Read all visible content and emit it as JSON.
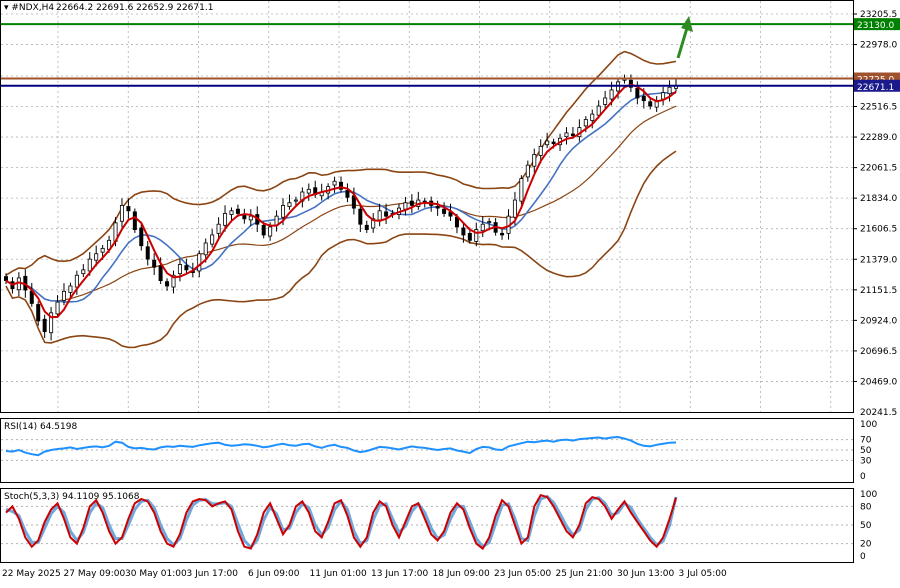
{
  "header": {
    "symbol": "#NDX,H4",
    "ohlc": "22664.2 22691.6 22652.9 22671.1"
  },
  "colors": {
    "candle": "#000000",
    "bollinger": "#8b4513",
    "ma_fast": "#cc0000",
    "ma_slow": "#4472c4",
    "rsi": "#1e90ff",
    "stoch_main": "#cc0000",
    "stoch_signal": "#6fa8dc",
    "hline_green": "#008000",
    "hline_brown": "#a0522d",
    "hline_navy": "#000080",
    "label_green": "#008000",
    "label_brown": "#a0522d",
    "label_navy": "#1a1a8c",
    "arrow": "#2e8b22",
    "grid": "#b0b0b0"
  },
  "chart_data": [
    {
      "type": "candlestick",
      "title": "#NDX,H4",
      "ylim": [
        20241.5,
        23205.5
      ],
      "price_ticks": [
        20241.5,
        20469.0,
        20696.5,
        20924.0,
        21151.5,
        21379.0,
        21606.5,
        21834.0,
        22061.5,
        22289.0,
        22516.5,
        22744.0,
        22971.5
      ],
      "price_tick_labels": [
        "20241.5",
        "20469.0",
        "20696.5",
        "20924.0",
        "21151.5",
        "21379.0",
        "21606.5",
        "21834.0",
        "22061.5",
        "22289.0",
        "22516.5",
        "22744.0",
        "22978.0",
        "23205.5"
      ],
      "x_labels": [
        "22 May 2025",
        "27 May 09:00",
        "30 May 01:00",
        "3 Jun 17:00",
        "6 Jun 09:00",
        "11 Jun 01:00",
        "13 Jun 17:00",
        "18 Jun 09:00",
        "23 Jun 05:00",
        "25 Jun 21:00",
        "30 Jun 13:00",
        "3 Jul 05:00"
      ],
      "hlines": [
        {
          "name": "target",
          "value": 23130.0,
          "label": "23130.0",
          "color": "green"
        },
        {
          "name": "resistance",
          "value": 22725.0,
          "label": "22725.0",
          "color": "brown"
        },
        {
          "name": "current",
          "value": 22671.1,
          "label": "22671.1",
          "color": "navy"
        }
      ],
      "closes": [
        21220,
        21160,
        21240,
        21150,
        21050,
        20920,
        20840,
        20980,
        21060,
        21140,
        21180,
        21260,
        21300,
        21380,
        21420,
        21460,
        21520,
        21650,
        21780,
        21740,
        21600,
        21480,
        21380,
        21320,
        21220,
        21180,
        21260,
        21340,
        21300,
        21280,
        21420,
        21500,
        21560,
        21640,
        21720,
        21740,
        21720,
        21680,
        21700,
        21640,
        21560,
        21620,
        21700,
        21780,
        21800,
        21820,
        21880,
        21900,
        21860,
        21880,
        21920,
        21960,
        21900,
        21840,
        21760,
        21640,
        21600,
        21680,
        21740,
        21700,
        21720,
        21760,
        21800,
        21780,
        21820,
        21800,
        21780,
        21760,
        21720,
        21700,
        21620,
        21560,
        21520,
        21600,
        21640,
        21660,
        21580,
        21560,
        21700,
        21820,
        21980,
        22080,
        22160,
        22220,
        22260,
        22240,
        22280,
        22320,
        22300,
        22360,
        22420,
        22460,
        22520,
        22580,
        22640,
        22700,
        22720,
        22660,
        22580,
        22560,
        22520,
        22560,
        22620,
        22660,
        22671
      ]
    },
    {
      "type": "line",
      "title": "RSI(14) 64.5198",
      "ylim": [
        0,
        100
      ],
      "ticks": [
        0,
        30,
        50,
        70,
        100
      ],
      "values": [
        48,
        47,
        50,
        45,
        42,
        40,
        47,
        50,
        52,
        53,
        55,
        52,
        54,
        56,
        57,
        55,
        58,
        66,
        64,
        56,
        53,
        54,
        52,
        51,
        55,
        57,
        56,
        58,
        57,
        56,
        59,
        61,
        63,
        64,
        60,
        58,
        59,
        61,
        60,
        58,
        55,
        57,
        60,
        62,
        59,
        58,
        61,
        62,
        57,
        54,
        58,
        60,
        56,
        54,
        49,
        46,
        48,
        52,
        56,
        55,
        53,
        51,
        54,
        57,
        55,
        54,
        52,
        50,
        52,
        53,
        49,
        47,
        44,
        52,
        56,
        55,
        51,
        50,
        57,
        60,
        63,
        66,
        65,
        67,
        68,
        66,
        69,
        70,
        68,
        71,
        72,
        73,
        74,
        72,
        74,
        75,
        72,
        68,
        62,
        58,
        57,
        60,
        62,
        64,
        64.5
      ]
    },
    {
      "type": "line",
      "title": "Stoch(5,3,3) 94.1109 95.1068",
      "ylim": [
        0,
        100
      ],
      "ticks": [
        0,
        20,
        50,
        80,
        100
      ],
      "series": [
        {
          "values": [
            70,
            80,
            60,
            30,
            15,
            25,
            55,
            75,
            85,
            60,
            30,
            20,
            45,
            80,
            90,
            70,
            40,
            20,
            30,
            60,
            85,
            92,
            88,
            70,
            40,
            20,
            15,
            35,
            70,
            88,
            92,
            90,
            80,
            85,
            88,
            75,
            40,
            15,
            12,
            35,
            70,
            85,
            60,
            35,
            50,
            80,
            88,
            70,
            40,
            30,
            55,
            85,
            90,
            65,
            30,
            15,
            30,
            70,
            88,
            80,
            50,
            30,
            55,
            80,
            85,
            60,
            35,
            25,
            40,
            70,
            85,
            75,
            45,
            20,
            12,
            30,
            65,
            90,
            80,
            50,
            20,
            30,
            80,
            98,
            95,
            80,
            60,
            40,
            30,
            50,
            85,
            95,
            92,
            80,
            60,
            75,
            88,
            70,
            55,
            40,
            25,
            15,
            30,
            60,
            94.1
          ]
        },
        {
          "values": [
            75,
            72,
            65,
            40,
            22,
            22,
            45,
            68,
            80,
            70,
            40,
            25,
            38,
            70,
            85,
            78,
            50,
            28,
            28,
            50,
            75,
            88,
            90,
            78,
            50,
            28,
            18,
            28,
            58,
            82,
            90,
            91,
            84,
            84,
            86,
            80,
            52,
            25,
            14,
            26,
            58,
            78,
            68,
            42,
            45,
            70,
            84,
            78,
            50,
            34,
            46,
            75,
            88,
            75,
            40,
            20,
            25,
            58,
            82,
            84,
            60,
            38,
            48,
            72,
            84,
            70,
            45,
            28,
            34,
            60,
            80,
            80,
            55,
            28,
            15,
            22,
            52,
            82,
            84,
            60,
            28,
            25,
            65,
            92,
            96,
            86,
            68,
            48,
            34,
            42,
            75,
            92,
            94,
            85,
            66,
            70,
            85,
            78,
            60,
            45,
            30,
            18,
            24,
            50,
            95.1
          ]
        }
      ]
    }
  ]
}
